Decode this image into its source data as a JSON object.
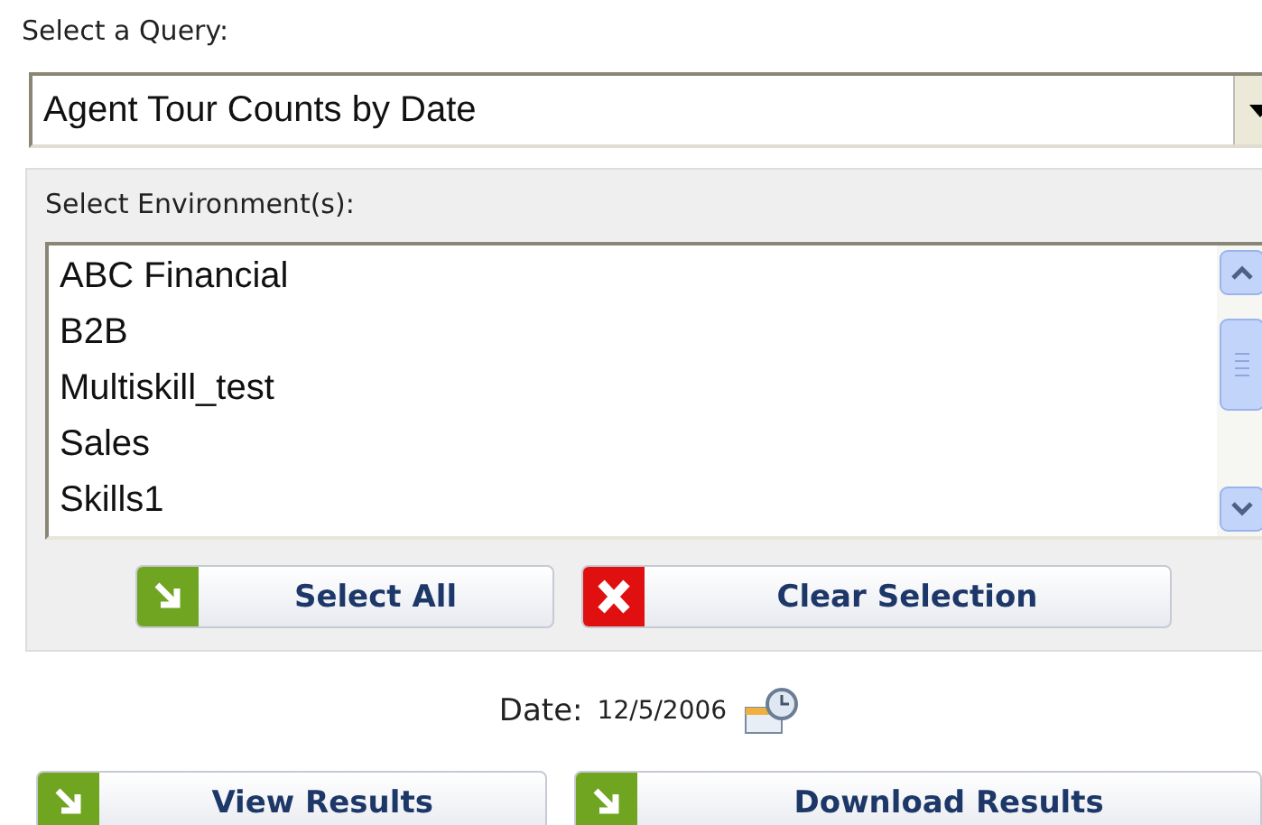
{
  "query": {
    "label": "Select a Query:",
    "value": "Agent Tour Counts by Date"
  },
  "environments": {
    "label": "Select Environment(s):",
    "items": [
      {
        "label": "ABC Financial",
        "selected": false
      },
      {
        "label": "B2B",
        "selected": false
      },
      {
        "label": "Multiskill_test",
        "selected": false
      },
      {
        "label": "Sales",
        "selected": false
      },
      {
        "label": "Skills1",
        "selected": false
      }
    ],
    "buttons": [
      {
        "label": "Select All",
        "kind": "arrow"
      },
      {
        "label": "Clear Selection",
        "kind": "cross"
      }
    ]
  },
  "date": {
    "label": "Date:",
    "value": "12/5/2006"
  },
  "actions": [
    {
      "label": "View Results",
      "kind": "arrow"
    },
    {
      "label": "Download Results",
      "kind": "arrow"
    }
  ]
}
